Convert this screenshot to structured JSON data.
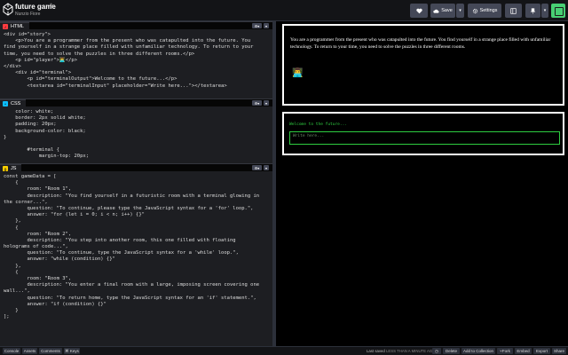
{
  "header": {
    "title": "future game",
    "author": "Nunzio Fiore",
    "save_label": "Save",
    "settings_label": "Settings"
  },
  "panes": {
    "html": {
      "label": "HTML",
      "icon": "html-icon",
      "icon_color": "#ff3c41",
      "lines": [
        "<div id=\"story\">",
        "    <p>You are a programmer from the present who was catapulted into the future. You",
        "find yourself in a strange place filled with unfamiliar technology. To return to your",
        "time, you need to solve the puzzles in three different rooms.</p>",
        "    <p id=\"player\">👨‍💻</p>",
        "</div>",
        "    <div id=\"terminal\">",
        "        <p id=\"terminalOutput\">Welcome to the future...</p>",
        "        <textarea id=\"terminalInput\" placeholder=\"Write here...\"></textarea>"
      ]
    },
    "css": {
      "label": "CSS",
      "icon": "css-icon",
      "icon_color": "#0ebeff",
      "lines": [
        "    color: white;",
        "    border: 2px solid white;",
        "    padding: 20px;",
        "    background-color: black;",
        "}",
        "",
        "        #terminal {",
        "            margin-top: 20px;"
      ]
    },
    "js": {
      "label": "JS",
      "icon": "js-icon",
      "icon_color": "#fcd000",
      "lines": [
        "const gameData = [",
        "    {",
        "        room: \"Room 1\",",
        "        description: \"You find yourself in a futuristic room with a terminal glowing in",
        "the corner...\",",
        "        question: \"To continue, please type the JavaScript syntax for a 'for' loop.\",",
        "        answer: \"for (let i = 0; i < n; i++) {}\"",
        "    },",
        "    {",
        "        room: \"Room 2\",",
        "        description: \"You step into another room, this one filled with floating",
        "holograms of code...\",",
        "        question: \"To continue, type the JavaScript syntax for a 'while' loop.\",",
        "        answer: \"while (condition) {}\"",
        "    },",
        "    {",
        "        room: \"Room 3\",",
        "        description: \"You enter a final room with a large, imposing screen covering one",
        "wall...\",",
        "        question: \"To return home, type the JavaScript syntax for an 'if' statement.\",",
        "        answer: \"if (condition) {}\"",
        "    }",
        "];"
      ]
    }
  },
  "preview": {
    "story_text": "You are a programmer from the present who was catapulted into the future. You find yourself in a strange place filled with unfamiliar technology. To return to your time, you need to solve the puzzles in three different rooms.",
    "player_emoji": "👨‍💻",
    "terminal_output": "Welcome to the future...",
    "terminal_placeholder": "Write here..."
  },
  "footer": {
    "console": "Console",
    "assets": "Assets",
    "comments": "Comments",
    "keys": "⌘ Keys",
    "last_saved_label": "Last saved",
    "last_saved_value": "LESS THAN A MINUTE AGO",
    "delete": "Delete",
    "add_to_collection": "Add to Collection",
    "fork": "Fork",
    "embed": "Embed",
    "export": "Export",
    "share": "Share"
  },
  "colors": {
    "bg": "#000000",
    "editor_bg": "#1d1e22",
    "header_bg": "#131417",
    "button_bg": "#444857",
    "accent_green": "#47cf73",
    "terminal_green": "#2ecc40"
  }
}
